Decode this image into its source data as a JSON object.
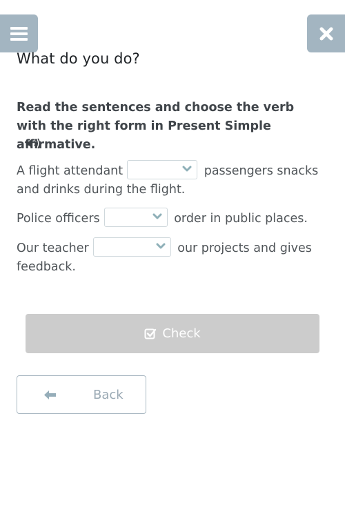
{
  "header": {
    "menu_icon": "hamburger-icon",
    "close_icon": "close-x-icon"
  },
  "exercise": {
    "title": "What do you do?",
    "instruction": "Read the sentences and choose the verb with the right form in Present Simple affirmative.",
    "audio_icon": "speaker-icon",
    "sentences": [
      {
        "before": "A flight attendant",
        "selected": "",
        "after": "passengers snacks and drinks during the flight."
      },
      {
        "before": "Police officers",
        "selected": "",
        "after": "order in public places."
      },
      {
        "before": "Our teacher",
        "selected": "",
        "after": "our projects and gives feedback."
      }
    ]
  },
  "actions": {
    "check_label": "Check",
    "check_icon": "checkbox-checked-icon",
    "back_label": "Back",
    "back_icon": "arrow-left-icon"
  },
  "colors": {
    "header_button_bg": "#a3b5c1",
    "check_button_bg": "#cccccc",
    "chevron": "#8fb0b8",
    "back_border": "#a9b8c2",
    "back_text": "#9aa9b4"
  }
}
